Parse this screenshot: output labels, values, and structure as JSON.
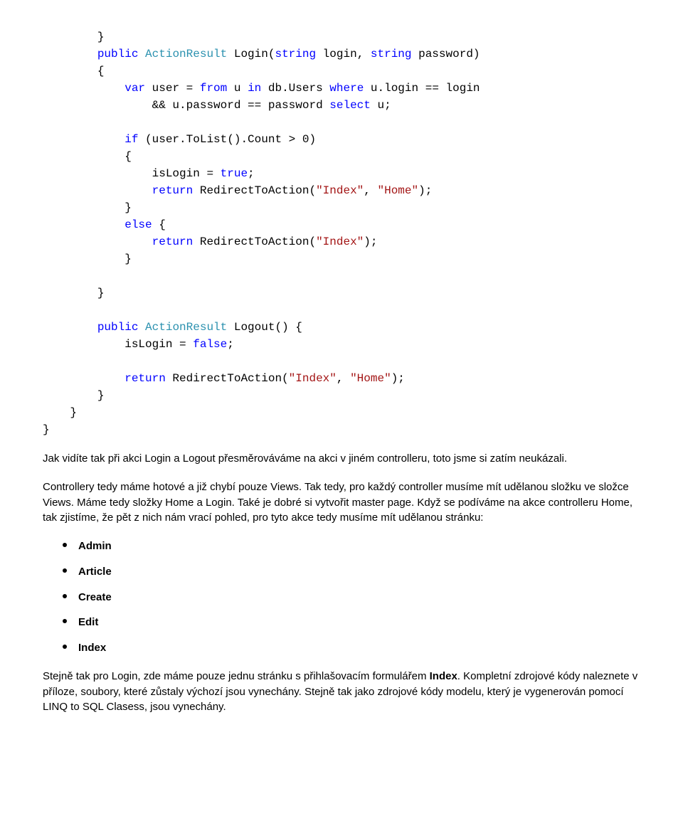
{
  "code": {
    "l1": "        }",
    "l2_a": "        ",
    "l2_b": "public",
    "l2_c": " ",
    "l2_d": "ActionResult",
    "l2_e": " Login(",
    "l2_f": "string",
    "l2_g": " login, ",
    "l2_h": "string",
    "l2_i": " password)",
    "l3": "        {",
    "l4_a": "            ",
    "l4_b": "var",
    "l4_c": " user = ",
    "l4_d": "from",
    "l4_e": " u ",
    "l4_f": "in",
    "l4_g": " db.Users ",
    "l4_h": "where",
    "l4_i": " u.login == login",
    "l5_a": "                && u.password == password ",
    "l5_b": "select",
    "l5_c": " u;",
    "l6": "",
    "l7_a": "            ",
    "l7_b": "if",
    "l7_c": " (user.ToList().Count > 0)",
    "l8": "            {",
    "l9_a": "                isLogin = ",
    "l9_b": "true",
    "l9_c": ";",
    "l10_a": "                ",
    "l10_b": "return",
    "l10_c": " RedirectToAction(",
    "l10_d": "\"Index\"",
    "l10_e": ", ",
    "l10_f": "\"Home\"",
    "l10_g": ");",
    "l11": "            }",
    "l12_a": "            ",
    "l12_b": "else",
    "l12_c": " {",
    "l13_a": "                ",
    "l13_b": "return",
    "l13_c": " RedirectToAction(",
    "l13_d": "\"Index\"",
    "l13_e": ");",
    "l14": "            }",
    "l15": "",
    "l16": "        }",
    "l17": "",
    "l18_a": "        ",
    "l18_b": "public",
    "l18_c": " ",
    "l18_d": "ActionResult",
    "l18_e": " Logout() {",
    "l19_a": "            isLogin = ",
    "l19_b": "false",
    "l19_c": ";",
    "l20": "",
    "l21_a": "            ",
    "l21_b": "return",
    "l21_c": " RedirectToAction(",
    "l21_d": "\"Index\"",
    "l21_e": ", ",
    "l21_f": "\"Home\"",
    "l21_g": ");",
    "l22": "        }",
    "l23": "    }",
    "l24": "}"
  },
  "para1": "    Jak vidíte tak při akci Login a Logout přesměrováváme na akci v jiném controlleru, toto jsme si zatím neukázali.",
  "para2": "    Controllery tedy máme hotové a již chybí pouze Views. Tak tedy, pro každý controller musíme mít udělanou složku ve složce Views. Máme tedy složky Home a Login. Také je dobré si vytvořit master page. Když se podíváme na akce controlleru Home, tak zjistíme, že pět z nich nám vrací pohled, pro tyto akce tedy musíme mít udělanou stránku:",
  "bullets": {
    "b1": "Admin",
    "b2": "Article",
    "b3": "Create",
    "b4": "Edit",
    "b5": "Index"
  },
  "para3_a": "Stejně tak pro Login, zde máme pouze jednu stránku s přihlašovacím formulářem ",
  "para3_b": "Index",
  "para3_c": ". Kompletní zdrojové kódy naleznete v příloze, soubory, které zůstaly výchozí jsou vynechány. Stejně tak jako zdrojové kódy modelu, který je vygenerován pomocí LINQ to SQL Clasess, jsou vynechány."
}
